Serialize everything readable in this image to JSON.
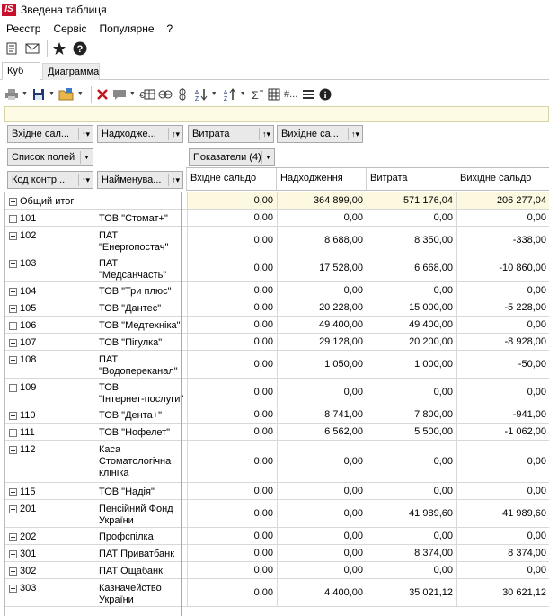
{
  "window": {
    "title": "Зведена таблиця",
    "logo": "IS"
  },
  "menu": [
    "Реєстр",
    "Сервіс",
    "Популярне",
    "?"
  ],
  "icons": [
    "document-icon",
    "mail-icon",
    "star-icon",
    "help-icon"
  ],
  "tabs": [
    {
      "label": "Куб",
      "active": true
    },
    {
      "label": "Диаграмма",
      "active": false
    }
  ],
  "toolbar": {
    "filter_text": "",
    "grid_label": "#..."
  },
  "fields": {
    "data": [
      {
        "label": "Вхідне сал...",
        "sort": "↑▾"
      },
      {
        "label": "Надходже...",
        "sort": "↑▾"
      },
      {
        "label": "Витрата",
        "sort": "↑▾"
      },
      {
        "label": "Вихідне са...",
        "sort": "↑▾"
      }
    ],
    "field_list": {
      "label": "Список полей"
    },
    "indicators": {
      "label": "Показатели (4)"
    },
    "row_fields": [
      {
        "label": "Код контр...",
        "sort": "↑▾"
      },
      {
        "label": "Найменува...",
        "sort": "↑▾"
      }
    ]
  },
  "columns": [
    "Вхідне сальдо",
    "Надходження",
    "Витрата",
    "Вихідне сальдо"
  ],
  "rows": [
    {
      "code": "Общий итог",
      "name": "",
      "v1": "0,00",
      "v2": "364 899,00",
      "v3": "571 176,04",
      "v4": "206 277,04",
      "total": true
    },
    {
      "code": "101",
      "name": "ТОВ \"Стомат+\"",
      "v1": "0,00",
      "v2": "0,00",
      "v3": "0,00",
      "v4": "0,00"
    },
    {
      "code": "102",
      "name": "ПАТ\n\"Енергопостач\"",
      "v1": "0,00",
      "v2": "8 688,00",
      "v3": "8 350,00",
      "v4": "-338,00"
    },
    {
      "code": "103",
      "name": "ПАТ\n\"Медсанчасть\"",
      "v1": "0,00",
      "v2": "17 528,00",
      "v3": "6 668,00",
      "v4": "-10 860,00"
    },
    {
      "code": "104",
      "name": "ТОВ \"Три плюс\"",
      "v1": "0,00",
      "v2": "0,00",
      "v3": "0,00",
      "v4": "0,00"
    },
    {
      "code": "105",
      "name": "ТОВ \"Дантес\"",
      "v1": "0,00",
      "v2": "20 228,00",
      "v3": "15 000,00",
      "v4": "-5 228,00"
    },
    {
      "code": "106",
      "name": "ТОВ \"Медтехніка\"",
      "v1": "0,00",
      "v2": "49 400,00",
      "v3": "49 400,00",
      "v4": "0,00"
    },
    {
      "code": "107",
      "name": "ТОВ \"Пігулка\"",
      "v1": "0,00",
      "v2": "29 128,00",
      "v3": "20 200,00",
      "v4": "-8 928,00"
    },
    {
      "code": "108",
      "name": "ПАТ\n\"Водопереканал\"",
      "v1": "0,00",
      "v2": "1 050,00",
      "v3": "1 000,00",
      "v4": "-50,00"
    },
    {
      "code": "109",
      "name": "ТОВ\n\"Інтернет-послуги\"",
      "v1": "0,00",
      "v2": "0,00",
      "v3": "0,00",
      "v4": "0,00"
    },
    {
      "code": "110",
      "name": "ТОВ \"Дента+\"",
      "v1": "0,00",
      "v2": "8 741,00",
      "v3": "7 800,00",
      "v4": "-941,00"
    },
    {
      "code": "111",
      "name": "ТОВ \"Нофелет\"",
      "v1": "0,00",
      "v2": "6 562,00",
      "v3": "5 500,00",
      "v4": "-1 062,00"
    },
    {
      "code": "112",
      "name": "Каса\nСтоматологічна\nклініка",
      "v1": "0,00",
      "v2": "0,00",
      "v3": "0,00",
      "v4": "0,00"
    },
    {
      "code": "115",
      "name": "ТОВ \"Надія\"",
      "v1": "0,00",
      "v2": "0,00",
      "v3": "0,00",
      "v4": "0,00"
    },
    {
      "code": "201",
      "name": "Пенсійний Фонд\nУкраїни",
      "v1": "0,00",
      "v2": "0,00",
      "v3": "41 989,60",
      "v4": "41 989,60"
    },
    {
      "code": "202",
      "name": "Профспілка",
      "v1": "0,00",
      "v2": "0,00",
      "v3": "0,00",
      "v4": "0,00"
    },
    {
      "code": "301",
      "name": "ПАТ Приватбанк",
      "v1": "0,00",
      "v2": "0,00",
      "v3": "8 374,00",
      "v4": "8 374,00"
    },
    {
      "code": "302",
      "name": "ПАТ Ощабанк",
      "v1": "0,00",
      "v2": "0,00",
      "v3": "0,00",
      "v4": "0,00"
    },
    {
      "code": "303",
      "name": "Казначейство\nУкраїни",
      "v1": "0,00",
      "v2": "4 400,00",
      "v3": "35 021,12",
      "v4": "30 621,12"
    }
  ]
}
